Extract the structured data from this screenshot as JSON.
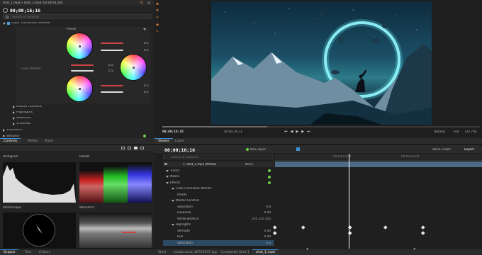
{
  "controls": {
    "title": "shot_1.mp4 » shot_1.mp4 [00:00:01;00]",
    "timecode": "00;00;16;16",
    "search_placeholder": "Search in Controls",
    "section": "Color Correction Wheels",
    "preset": "Preset",
    "wheels_label": "Color Wheels",
    "values": [
      "0.5",
      "0.5",
      "0.5",
      "0.5",
      "0.5",
      "0.5"
    ],
    "items": [
      "Master Controls",
      "Highlights",
      "Midtones",
      "Shadows"
    ],
    "transform": "Transform",
    "behavior": "Behavior",
    "tabs": [
      "Controls",
      "Media",
      "Track"
    ]
  },
  "viewer": {
    "timecode": "00;00;16;16",
    "end_timecode": "00;00;34;23",
    "options": "Options",
    "quality": "Full",
    "zoom": "(22.7%)",
    "tabs": [
      "Viewer",
      "Layer"
    ],
    "progress": 0.33
  },
  "scopes": {
    "histogram": "Histogram",
    "parade": "Parade",
    "vectorscope": "Vectorscope",
    "waveform": "Waveform",
    "tabs": [
      "Scopes",
      "Text",
      "History"
    ]
  },
  "timeline": {
    "timecode": "00;00;16;16",
    "new_layer": "New Layer",
    "value_graph": "Value Graph",
    "export": "Export",
    "search_placeholder": "Search in Timeline",
    "layer_name": "1. shot_1.mp4 [Media]",
    "blend": "None",
    "ruler": [
      "00;00;10;00",
      "00;00;20;00"
    ],
    "rows": [
      {
        "label": "Tracks",
        "indent": 0
      },
      {
        "label": "Masks",
        "indent": 0
      },
      {
        "label": "Effects",
        "indent": 0
      },
      {
        "label": "Color Correction Wheels",
        "indent": 1
      },
      {
        "label": "Preset",
        "indent": 2
      },
      {
        "label": "Master Controls",
        "indent": 1
      },
      {
        "label": "Saturation",
        "indent": 2,
        "value": "0.8"
      },
      {
        "label": "Exposure",
        "indent": 2,
        "value": "0.00"
      },
      {
        "label": "White Balance",
        "indent": 2,
        "value": "255  255  255"
      },
      {
        "label": "Highlights",
        "indent": 1
      },
      {
        "label": "Strength",
        "indent": 2,
        "value": "0.00"
      },
      {
        "label": "Hue",
        "indent": 2,
        "value": "0.00"
      },
      {
        "label": "Saturation",
        "indent": 2,
        "value": "0.5"
      }
    ],
    "bottom_tabs": [
      "Start",
      "studiocloud_46763037.jpg",
      "Composite Shot 1",
      "shot_1.mp4"
    ],
    "colors": {
      "accent": "#3d8fd6",
      "green": "#6ed14a",
      "playhead": "#ffffff"
    }
  }
}
